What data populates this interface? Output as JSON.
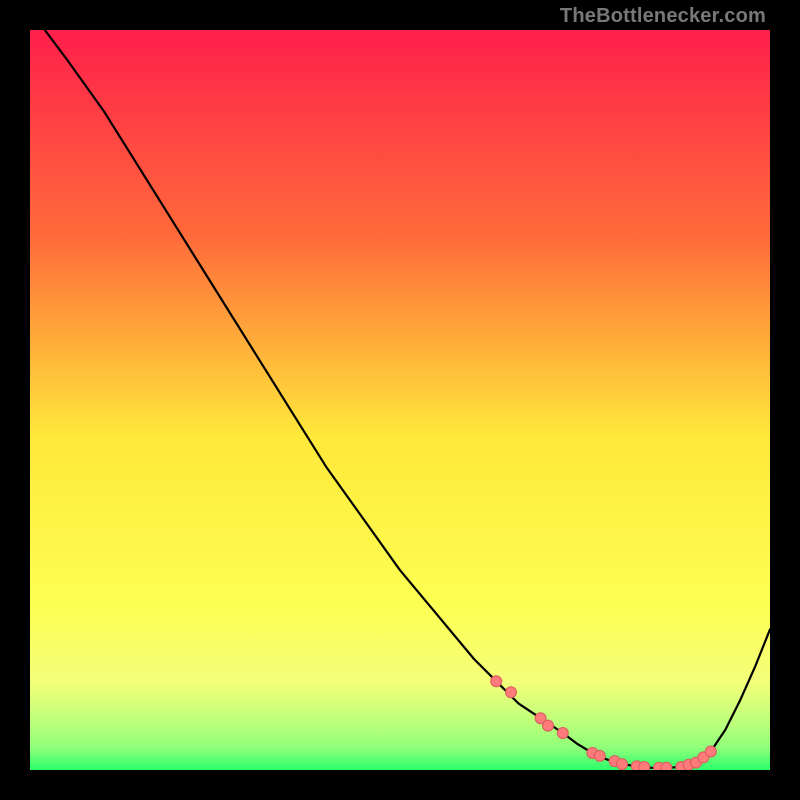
{
  "watermark": "TheBottlenecker.com",
  "colors": {
    "top": "#ff1f4b",
    "mid_upper": "#ff7a3a",
    "mid": "#ffe93a",
    "lower": "#f4ff7a",
    "green_light": "#b8ff7a",
    "green": "#2aff6a",
    "curve": "#000000",
    "marker": "#ff7a7a",
    "marker_stroke": "#d95c5c"
  },
  "chart_data": {
    "type": "line",
    "title": "",
    "xlabel": "",
    "ylabel": "",
    "xlim": [
      0,
      100
    ],
    "ylim": [
      0,
      100
    ],
    "series": [
      {
        "name": "bottleneck-curve",
        "x": [
          2,
          5,
          10,
          15,
          20,
          25,
          30,
          35,
          40,
          45,
          50,
          55,
          60,
          63,
          66,
          69,
          72,
          74,
          76,
          78,
          80,
          82,
          84,
          86,
          88,
          90,
          92,
          94,
          96,
          98,
          100
        ],
        "y": [
          100,
          96,
          89,
          81,
          73,
          65,
          57,
          49,
          41,
          34,
          27,
          21,
          15,
          12,
          9,
          7,
          5,
          3.5,
          2.3,
          1.4,
          0.8,
          0.5,
          0.3,
          0.3,
          0.4,
          1.0,
          2.5,
          5.5,
          9.5,
          14,
          19
        ]
      }
    ],
    "markers": {
      "name": "highlighted-points",
      "x": [
        63,
        65,
        69,
        70,
        72,
        76,
        77,
        79,
        80,
        82,
        83,
        85,
        86,
        88,
        89,
        90,
        91,
        92
      ],
      "y": [
        12,
        10.5,
        7,
        6,
        5,
        2.3,
        1.9,
        1.2,
        0.8,
        0.5,
        0.4,
        0.3,
        0.3,
        0.4,
        0.7,
        1.0,
        1.7,
        2.5
      ]
    }
  }
}
